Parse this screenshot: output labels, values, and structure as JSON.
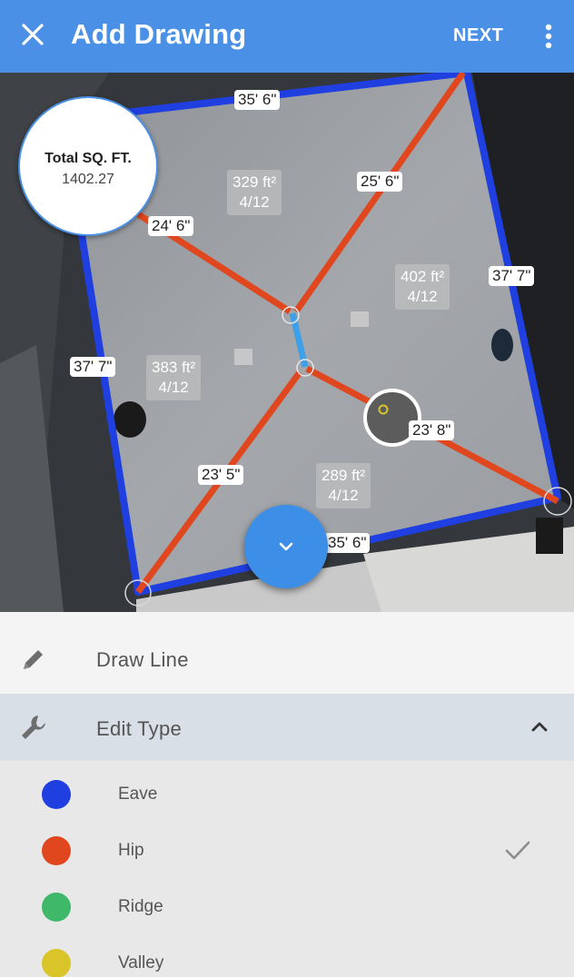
{
  "appbar": {
    "title": "Add Drawing",
    "next_label": "NEXT",
    "background": "#4a90e6"
  },
  "map": {
    "total": {
      "label": "Total SQ. FT.",
      "value": "1402.27"
    },
    "lengths": [
      "35' 6\"",
      "25' 6\"",
      "24' 6\"",
      "37' 7\"",
      "37' 7\"",
      "23' 8\"",
      "23' 5\"",
      "35' 6\""
    ],
    "areas": [
      {
        "value": "329 ft²",
        "pitch": "4/12"
      },
      {
        "value": "402 ft²",
        "pitch": "4/12"
      },
      {
        "value": "383 ft²",
        "pitch": "4/12"
      },
      {
        "value": "289 ft²",
        "pitch": "4/12"
      }
    ]
  },
  "panel": {
    "draw_line_label": "Draw Line",
    "edit_type_label": "Edit Type",
    "types": [
      {
        "label": "Eave",
        "color": "#1f3fe0",
        "selected": false
      },
      {
        "label": "Hip",
        "color": "#e0471f",
        "selected": true
      },
      {
        "label": "Ridge",
        "color": "#3fb86a",
        "selected": false
      },
      {
        "label": "Valley",
        "color": "#d9c52a",
        "selected": false
      }
    ]
  },
  "icons": {
    "close": "close-icon",
    "more": "more-vert-icon",
    "pencil": "pencil-icon",
    "wrench": "wrench-icon",
    "chevron_up": "chevron-up-icon",
    "chevron_down": "chevron-down-icon",
    "check": "check-icon"
  }
}
